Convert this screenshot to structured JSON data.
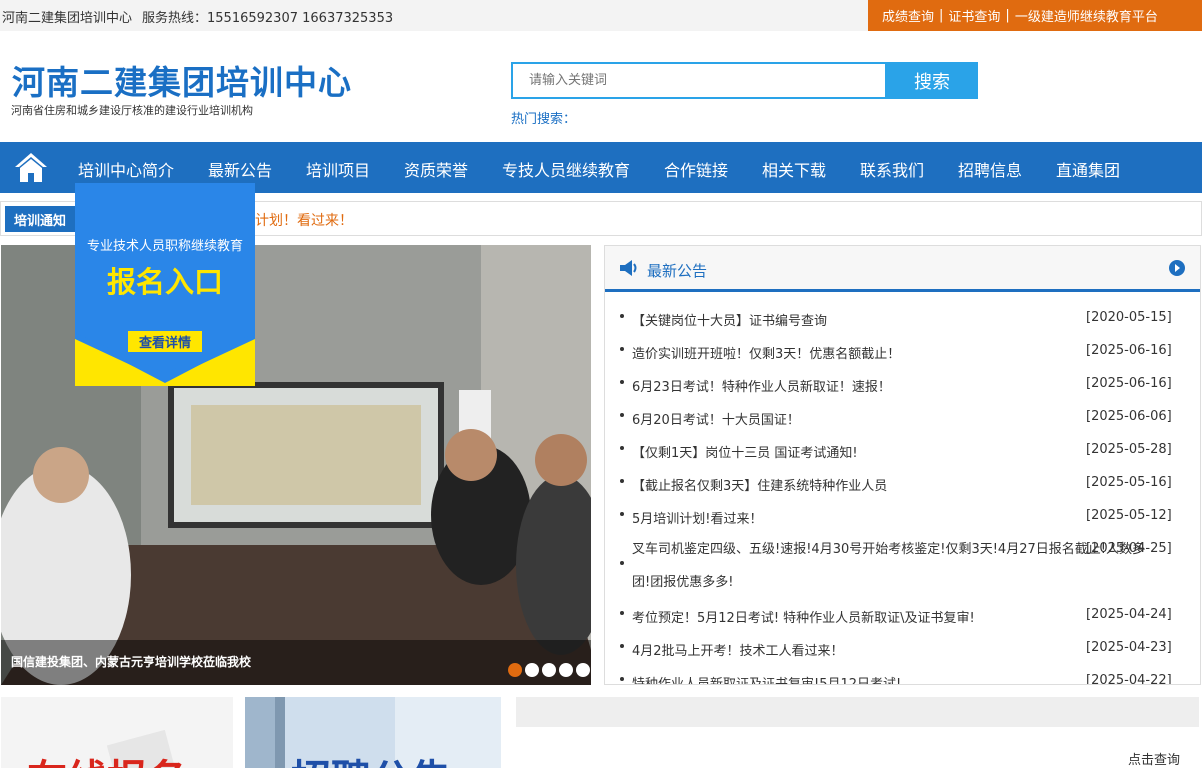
{
  "topbar": {
    "org": "河南二建集团培训中心",
    "hotline": "服务热线：15516592307 16637325353",
    "links": [
      "成绩查询",
      "证书查询",
      "一级建造师继续教育平台"
    ],
    "sep": "|"
  },
  "header": {
    "title": "河南二建集团培训中心",
    "subtitle": "河南省住房和城乡建设厅核准的建设行业培训机构",
    "search_placeholder": "请输入关键词",
    "search_button": "搜索",
    "hot_label": "热门搜索："
  },
  "nav": {
    "items": [
      "培训中心简介",
      "最新公告",
      "培训项目",
      "资质荣誉",
      "专技人员继续教育",
      "合作链接",
      "相关下载",
      "联系我们",
      "招聘信息",
      "直通集团"
    ]
  },
  "notice": {
    "tag": "培训通知",
    "text": "计划！看过来！"
  },
  "popup": {
    "line1": "专业技术人员职称继续教育",
    "line2": "报名入口",
    "button": "查看详情"
  },
  "slider": {
    "caption": "国信建投集团、内蒙古元亨培训学校莅临我校",
    "dots": 5,
    "active_dot": 0
  },
  "announcements": {
    "title": "最新公告",
    "items": [
      {
        "text": "【关键岗位十大员】证书编号查询",
        "date": "[2020-05-15]"
      },
      {
        "text": "造价实训班开班啦！仅剩3天！优惠名额截止！",
        "date": "[2025-06-16]"
      },
      {
        "text": "6月23日考试！特种作业人员新取证！速报！",
        "date": "[2025-06-16]"
      },
      {
        "text": "6月20日考试！十大员国证！",
        "date": "[2025-06-06]"
      },
      {
        "text": "【仅剩1天】岗位十三员 国证考试通知!",
        "date": "[2025-05-28]"
      },
      {
        "text": "【截止报名仅剩3天】住建系统特种作业人员",
        "date": "[2025-05-16]"
      },
      {
        "text": "5月培训计划!看过来！",
        "date": "[2025-05-12]"
      },
      {
        "text": "叉车司机鉴定四级、五级!速报!4月30号开始考核鉴定!仅剩3天!4月27日报名截止!人数多团!团报优惠多多!",
        "date": "[2025-04-25]",
        "tall": true
      },
      {
        "text": "考位预定！5月12日考试! 特种作业人员新取证\\及证书复审!",
        "date": "[2025-04-24]"
      },
      {
        "text": "4月2批马上开考！技术工人看过来！",
        "date": "[2025-04-23]"
      },
      {
        "text": "特种作业人员新取证及证书复审!5月12日考试!",
        "date": "[2025-04-22]"
      }
    ]
  },
  "banners": {
    "left": "在线报名",
    "middle": "招聘公告"
  },
  "query_link": "点击查询",
  "colors": {
    "brand_blue": "#1e6fc0",
    "accent_orange": "#e06b10",
    "search_blue": "#2aa3e8"
  }
}
